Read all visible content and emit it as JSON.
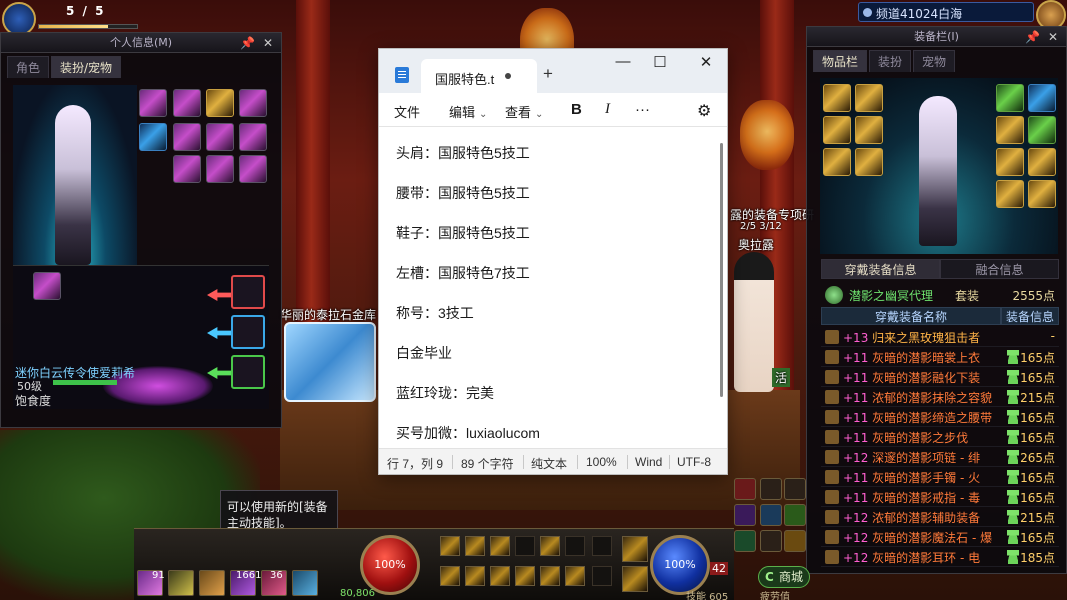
{
  "status": {
    "fatigue": "5 / 5",
    "pet_level_tag": "50级"
  },
  "char_panel": {
    "title": "个人信息(M)",
    "tabs": [
      {
        "label": "角色"
      },
      {
        "label": "装扮/宠物"
      }
    ],
    "pet": {
      "name": "迷你白云传令使爱莉希",
      "level": "50级",
      "satiety_label": "饱食度"
    }
  },
  "channel": {
    "label": "频道41024白海"
  },
  "equip_panel": {
    "title": "装备栏(I)",
    "tabs": [
      {
        "label": "物品栏"
      },
      {
        "label": "装扮"
      },
      {
        "label": "宠物"
      }
    ],
    "sub_tabs": [
      {
        "label": "穿戴装备信息"
      },
      {
        "label": "融合信息"
      }
    ],
    "set": {
      "name": "潜影之幽冥代理",
      "type": "套装",
      "points": "2555点"
    },
    "columns": [
      {
        "label": "穿戴装备名称"
      },
      {
        "label": "装备信息"
      }
    ],
    "items": [
      {
        "level": "+13",
        "name": "归来之黑玫瑰狙击者",
        "points": "-",
        "legend": true
      },
      {
        "level": "+11",
        "name": "灰暗的潜影暗裳上衣",
        "points": "165点"
      },
      {
        "level": "+11",
        "name": "灰暗的潜影融化下装",
        "points": "165点"
      },
      {
        "level": "+11",
        "name": "浓郁的潜影抹除之容貌",
        "points": "215点"
      },
      {
        "level": "+11",
        "name": "灰暗的潜影缔造之腰带",
        "points": "165点"
      },
      {
        "level": "+11",
        "name": "灰暗的潜影之步伐",
        "points": "165点"
      },
      {
        "level": "+12",
        "name": "深邃的潜影项链 - 绯",
        "points": "265点"
      },
      {
        "level": "+11",
        "name": "灰暗的潜影手镯 - 火",
        "points": "165点"
      },
      {
        "level": "+11",
        "name": "灰暗的潜影戒指 - 毒",
        "points": "165点"
      },
      {
        "level": "+12",
        "name": "浓郁的潜影辅助装备",
        "points": "215点"
      },
      {
        "level": "+12",
        "name": "灰暗的潜影魔法石 - 爆",
        "points": "165点"
      },
      {
        "level": "+12",
        "name": "灰暗的潜影耳环 - 电",
        "points": "185点"
      }
    ]
  },
  "scene": {
    "labels": {
      "chest": "华丽的泰拉石金库",
      "quest": "露的装备专项研",
      "quest_progress": "2/5 3/12",
      "npc": "奥拉露",
      "activity": "活"
    }
  },
  "notepad": {
    "tab_title": "国服特色.t",
    "menus": {
      "file": "文件",
      "edit": "编辑",
      "view": "查看"
    },
    "format": {
      "bold": "B",
      "italic": "I",
      "more": "···"
    },
    "lines": [
      "头肩：国服特色5技工",
      "腰带：国服特色5技工",
      "鞋子：国服特色5技工",
      "左槽：国服特色7技工",
      "称号：3技工",
      "白金毕业",
      "蓝红玲珑：完美",
      "买号加微：luxiaolucom"
    ],
    "status": {
      "position": "行 7，列 9",
      "chars": "89 个字符",
      "mode": "纯文本",
      "zoom": "100%",
      "line_ending": "Wind",
      "encoding": "UTF-8"
    }
  },
  "tooltip": {
    "line1": "可以使用新的[装备",
    "line2": "主动技能]。"
  },
  "hud": {
    "hp": "100%",
    "mp": "100%",
    "gold": "80,806",
    "skill_points": "技能 605",
    "level_badge": "42",
    "stack_91": "91",
    "stack_1661": "1661",
    "stack_36": "36",
    "fatigue_text": "疲劳值",
    "town": "商城"
  }
}
